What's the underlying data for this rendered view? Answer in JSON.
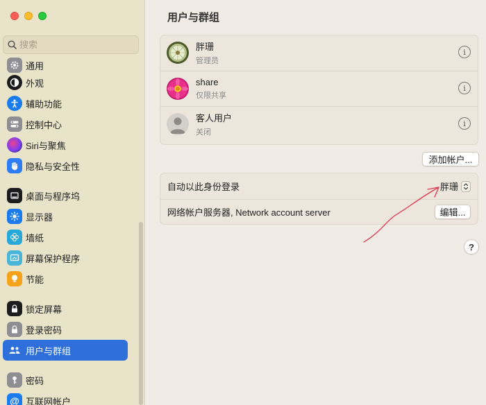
{
  "search": {
    "placeholder": "搜索"
  },
  "sidebar": {
    "items": [
      {
        "label": "通用",
        "icon": "gear-icon"
      },
      {
        "label": "外观",
        "icon": "appearance-icon"
      },
      {
        "label": "辅助功能",
        "icon": "accessibility-icon"
      },
      {
        "label": "控制中心",
        "icon": "control-center-icon"
      },
      {
        "label": "Siri与聚焦",
        "icon": "siri-icon"
      },
      {
        "label": "隐私与安全性",
        "icon": "hand-icon"
      },
      {
        "label": "桌面与程序坞",
        "icon": "dock-icon"
      },
      {
        "label": "显示器",
        "icon": "sun-icon"
      },
      {
        "label": "墙纸",
        "icon": "flower-icon"
      },
      {
        "label": "屏幕保护程序",
        "icon": "screensaver-icon"
      },
      {
        "label": "节能",
        "icon": "bulb-icon"
      },
      {
        "label": "锁定屏幕",
        "icon": "lock-icon"
      },
      {
        "label": "登录密码",
        "icon": "lock-icon"
      },
      {
        "label": "用户与群组",
        "icon": "users-icon"
      },
      {
        "label": "密码",
        "icon": "key-icon"
      },
      {
        "label": "互联网帐户",
        "icon": "at-icon"
      }
    ],
    "active_index": 13
  },
  "main": {
    "title": "用户与群组",
    "users": [
      {
        "name": "胖珊",
        "role": "管理员",
        "avatar": "dandelion-avatar"
      },
      {
        "name": "share",
        "role": "仅限共享",
        "avatar": "pink-flower-avatar"
      },
      {
        "name": "客人用户",
        "role": "关闭",
        "avatar": "generic-person-avatar"
      }
    ],
    "add_account_label": "添加帐户...",
    "auto_login_label": "自动以此身份登录",
    "auto_login_value": "胖珊",
    "network_server_label": "网络帐户服务器, Network account server",
    "edit_label": "编辑...",
    "help_label": "?"
  },
  "colors": {
    "accent": "#2f6fdb",
    "annotation": "#e0344a"
  }
}
